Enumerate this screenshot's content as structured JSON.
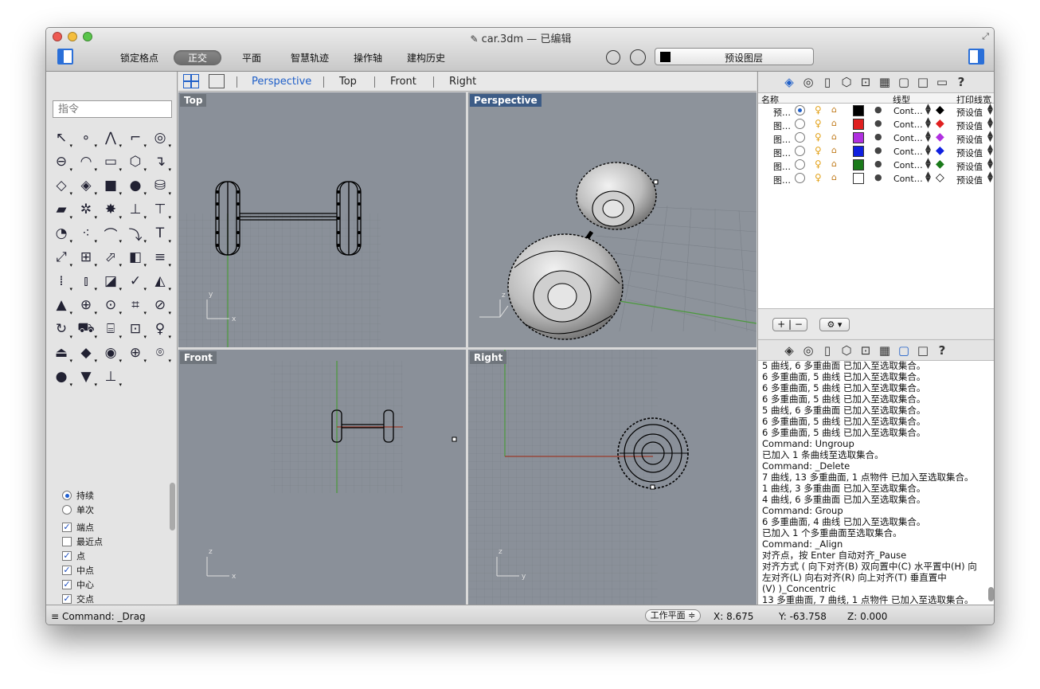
{
  "window": {
    "title": "car.3dm — 已编辑"
  },
  "toolbar": {
    "snap_grid": "锁定格点",
    "ortho": "正交",
    "planar": "平面",
    "smart_track": "智慧轨迹",
    "gumball": "操作轴",
    "history": "建构历史",
    "layer_select": "预设图层"
  },
  "command": {
    "placeholder": "指令",
    "status": "Command: _Drag"
  },
  "viewport_tabs": [
    "Perspective",
    "Top",
    "Front",
    "Right"
  ],
  "viewports": {
    "top": "Top",
    "perspective": "Perspective",
    "front": "Front",
    "right": "Right"
  },
  "osnap": {
    "persistent": "持续",
    "once": "单次",
    "items": [
      {
        "label": "端点",
        "checked": true
      },
      {
        "label": "最近点",
        "checked": false
      },
      {
        "label": "点",
        "checked": true
      },
      {
        "label": "中点",
        "checked": true
      },
      {
        "label": "中心",
        "checked": true
      },
      {
        "label": "交点",
        "checked": true
      }
    ]
  },
  "layers": {
    "col_name": "名称",
    "col_linetype": "线型",
    "col_printwidth": "打印线宽",
    "rows": [
      {
        "name": "预…",
        "current": true,
        "color": "#000000",
        "linetype": "Cont…",
        "printwidth": "预设值"
      },
      {
        "name": "图…",
        "current": false,
        "color": "#e02020",
        "linetype": "Cont…",
        "printwidth": "预设值"
      },
      {
        "name": "图…",
        "current": false,
        "color": "#b030e0",
        "linetype": "Cont…",
        "printwidth": "预设值"
      },
      {
        "name": "图…",
        "current": false,
        "color": "#1020e0",
        "linetype": "Cont…",
        "printwidth": "预设值"
      },
      {
        "name": "图…",
        "current": false,
        "color": "#1a7a1a",
        "linetype": "Cont…",
        "printwidth": "预设值"
      },
      {
        "name": "图…",
        "current": false,
        "color": "#ffffff",
        "linetype": "Cont…",
        "printwidth": "预设值"
      }
    ],
    "add_remove": "+ | −",
    "gear": "⚙ ▾"
  },
  "history": [
    "5 曲线, 6 多重曲面 已加入至选取集合。",
    "6 多重曲面, 5 曲线 已加入至选取集合。",
    "6 多重曲面, 5 曲线 已加入至选取集合。",
    "6 多重曲面, 5 曲线 已加入至选取集合。",
    "5 曲线, 6 多重曲面 已加入至选取集合。",
    "6 多重曲面, 5 曲线 已加入至选取集合。",
    "6 多重曲面, 5 曲线 已加入至选取集合。",
    "Command: Ungroup",
    "已加入 1 条曲线至选取集合。",
    "Command: _Delete",
    "7 曲线, 13 多重曲面, 1 点物件 已加入至选取集合。",
    "1 曲线, 3 多重曲面 已加入至选取集合。",
    "4 曲线, 6 多重曲面 已加入至选取集合。",
    "Command: Group",
    "6 多重曲面, 4 曲线 已加入至选取集合。",
    "已加入 1 个多重曲面至选取集合。",
    "Command: _Align",
    "对齐点，按 Enter 自动对齐_Pause",
    "对齐方式 ( 向下对齐(B) 双向置中(C) 水平置中(H) 向",
    "左对齐(L) 向右对齐(R) 向上对齐(T) 垂直置中",
    "(V) )_Concentric",
    "13 多重曲面, 7 曲线, 1 点物件 已加入至选取集合。"
  ],
  "status": {
    "cplane": "工作平面 ≑",
    "x": "X: 8.675",
    "y": "Y: -63.758",
    "z": "Z: 0.000"
  }
}
